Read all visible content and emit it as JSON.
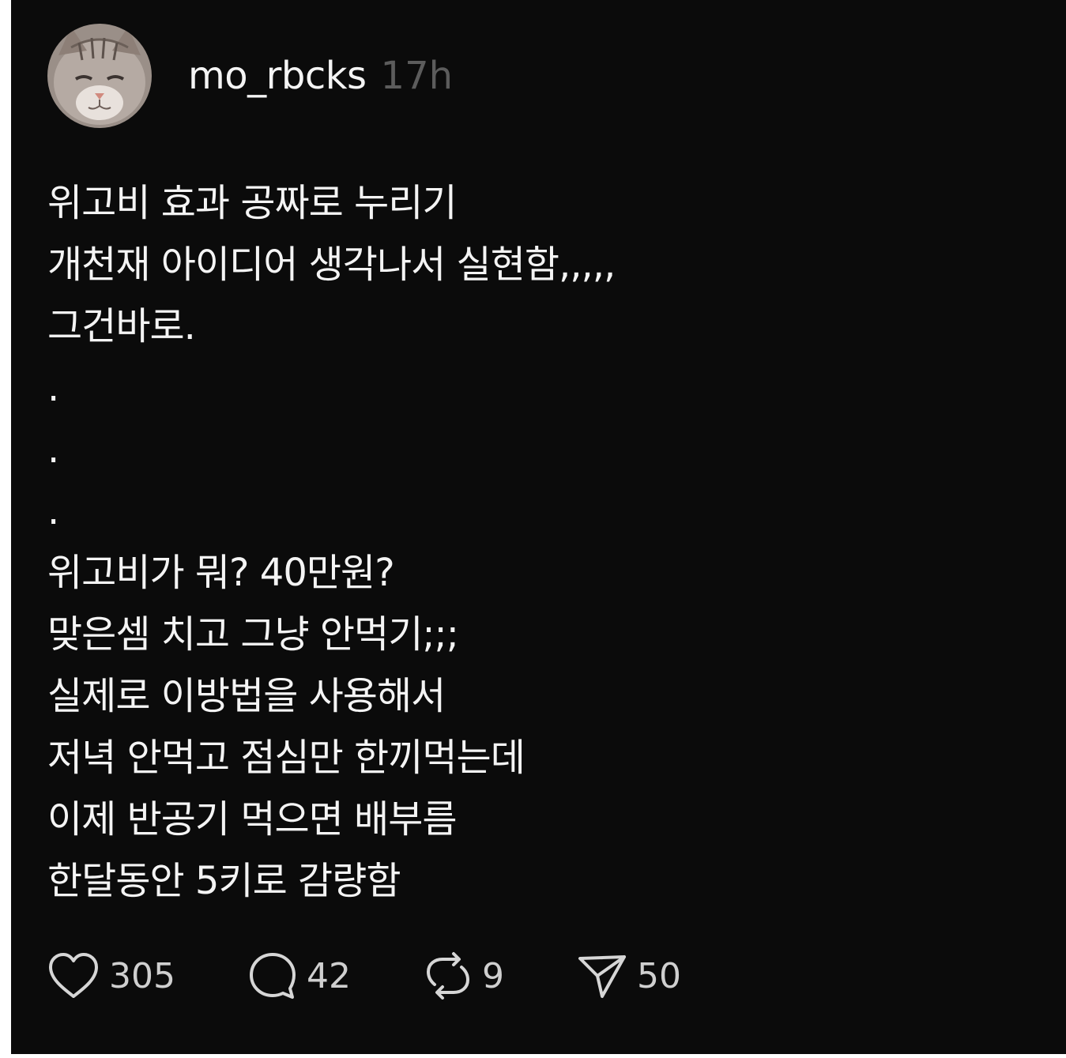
{
  "post": {
    "username": "mo_rbcks",
    "time": "17h",
    "lines": [
      "위고비 효과 공짜로 누리기",
      "개천재 아이디어 생각나서 실현함,,,,,",
      "그건바로.",
      ".",
      ".",
      ".",
      "위고비가 뭐? 40만원?",
      "맞은셈 치고 그냥 안먹기;;;",
      "실제로 이방법을 사용해서",
      "저녁 안먹고 점심만 한끼먹는데",
      "이제 반공기 먹으면 배부름",
      "한달동안 5키로 감량함"
    ]
  },
  "actions": {
    "likes": "305",
    "comments": "42",
    "reposts": "9",
    "shares": "50",
    "like_icon": "heart-icon",
    "comment_icon": "comment-bubble-icon",
    "repost_icon": "repost-icon",
    "share_icon": "send-icon"
  },
  "colors": {
    "background": "#0b0b0b",
    "text": "#f4f4f4",
    "muted": "#5c5c5c"
  }
}
